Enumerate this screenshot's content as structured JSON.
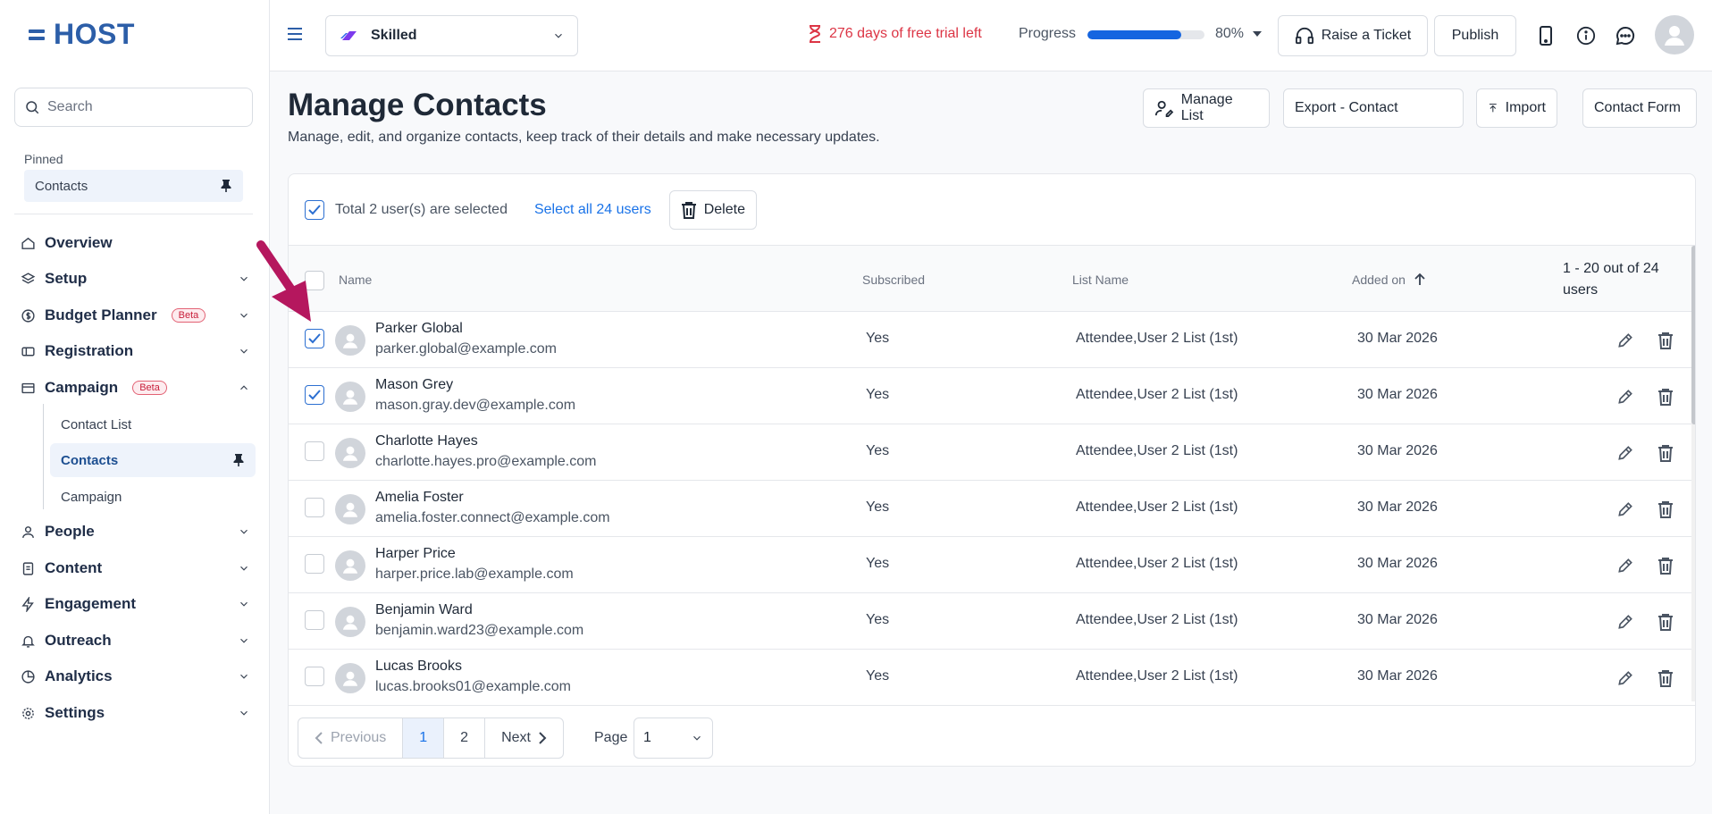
{
  "app": {
    "logo": "HOST"
  },
  "sidebar": {
    "search_placeholder": "Search",
    "pinned_label": "Pinned",
    "pinned_items": [
      {
        "label": "Contacts",
        "icon": "pin-icon"
      }
    ],
    "nav": [
      {
        "label": "Overview",
        "icon": "home-icon",
        "expandable": false
      },
      {
        "label": "Setup",
        "icon": "layers-icon",
        "expandable": true
      },
      {
        "label": "Budget Planner",
        "icon": "dollar-icon",
        "badge": "Beta",
        "expandable": true
      },
      {
        "label": "Registration",
        "icon": "ticket-icon",
        "expandable": true
      },
      {
        "label": "Campaign",
        "icon": "megaphone-icon",
        "badge": "Beta",
        "expandable": true,
        "expanded": true
      },
      {
        "label": "People",
        "icon": "users-icon",
        "expandable": true
      },
      {
        "label": "Content",
        "icon": "document-icon",
        "expandable": true
      },
      {
        "label": "Engagement",
        "icon": "bolt-icon",
        "expandable": true
      },
      {
        "label": "Outreach",
        "icon": "bell-icon",
        "expandable": true
      },
      {
        "label": "Analytics",
        "icon": "pie-chart-icon",
        "expandable": true
      },
      {
        "label": "Settings",
        "icon": "gear-icon",
        "expandable": true
      }
    ],
    "campaign_children": [
      {
        "label": "Contact List"
      },
      {
        "label": "Contacts",
        "active": true
      },
      {
        "label": "Campaign"
      }
    ]
  },
  "topbar": {
    "workspace": "Skilled",
    "trial_text": "276 days of free trial left",
    "progress_label": "Progress",
    "progress_value": 80,
    "progress_text": "80%",
    "raise_ticket": "Raise a Ticket",
    "publish": "Publish"
  },
  "page": {
    "title": "Manage Contacts",
    "subtitle": "Manage, edit, and organize contacts, keep track of their details and make necessary updates.",
    "buttons": {
      "manage_list": "Manage List",
      "export": "Export - Contact",
      "import": "Import",
      "contact_form": "Contact Form"
    }
  },
  "selection": {
    "text": "Total 2 user(s) are selected",
    "select_all": "Select all 24 users",
    "delete": "Delete"
  },
  "table": {
    "columns": {
      "name": "Name",
      "subscribed": "Subscribed",
      "list_name": "List Name",
      "added_on": "Added on"
    },
    "count_text": "1 - 20 out of 24 users",
    "rows": [
      {
        "name": "Parker Global",
        "email": "parker.global@example.com",
        "subscribed": "Yes",
        "list": "Attendee,User 2 List (1st)",
        "added": "30 Mar 2026",
        "checked": true
      },
      {
        "name": "Mason Grey",
        "email": "mason.gray.dev@example.com",
        "subscribed": "Yes",
        "list": "Attendee,User 2 List (1st)",
        "added": "30 Mar 2026",
        "checked": true
      },
      {
        "name": "Charlotte Hayes",
        "email": "charlotte.hayes.pro@example.com",
        "subscribed": "Yes",
        "list": "Attendee,User 2 List (1st)",
        "added": "30 Mar 2026",
        "checked": false
      },
      {
        "name": "Amelia Foster",
        "email": "amelia.foster.connect@example.com",
        "subscribed": "Yes",
        "list": "Attendee,User 2 List (1st)",
        "added": "30 Mar 2026",
        "checked": false
      },
      {
        "name": "Harper Price",
        "email": "harper.price.lab@example.com",
        "subscribed": "Yes",
        "list": "Attendee,User 2 List (1st)",
        "added": "30 Mar 2026",
        "checked": false
      },
      {
        "name": "Benjamin Ward",
        "email": "benjamin.ward23@example.com",
        "subscribed": "Yes",
        "list": "Attendee,User 2 List (1st)",
        "added": "30 Mar 2026",
        "checked": false
      },
      {
        "name": "Lucas Brooks",
        "email": "lucas.brooks01@example.com",
        "subscribed": "Yes",
        "list": "Attendee,User 2 List (1st)",
        "added": "30 Mar 2026",
        "checked": false
      }
    ]
  },
  "pagination": {
    "previous": "Previous",
    "pages": [
      "1",
      "2"
    ],
    "current": "1",
    "next": "Next",
    "page_label": "Page",
    "page_value": "1"
  },
  "colors": {
    "brand": "#2c5ea8",
    "accent": "#1a73e8",
    "danger": "#dc3545",
    "annotation_arrow": "#b5175e"
  }
}
